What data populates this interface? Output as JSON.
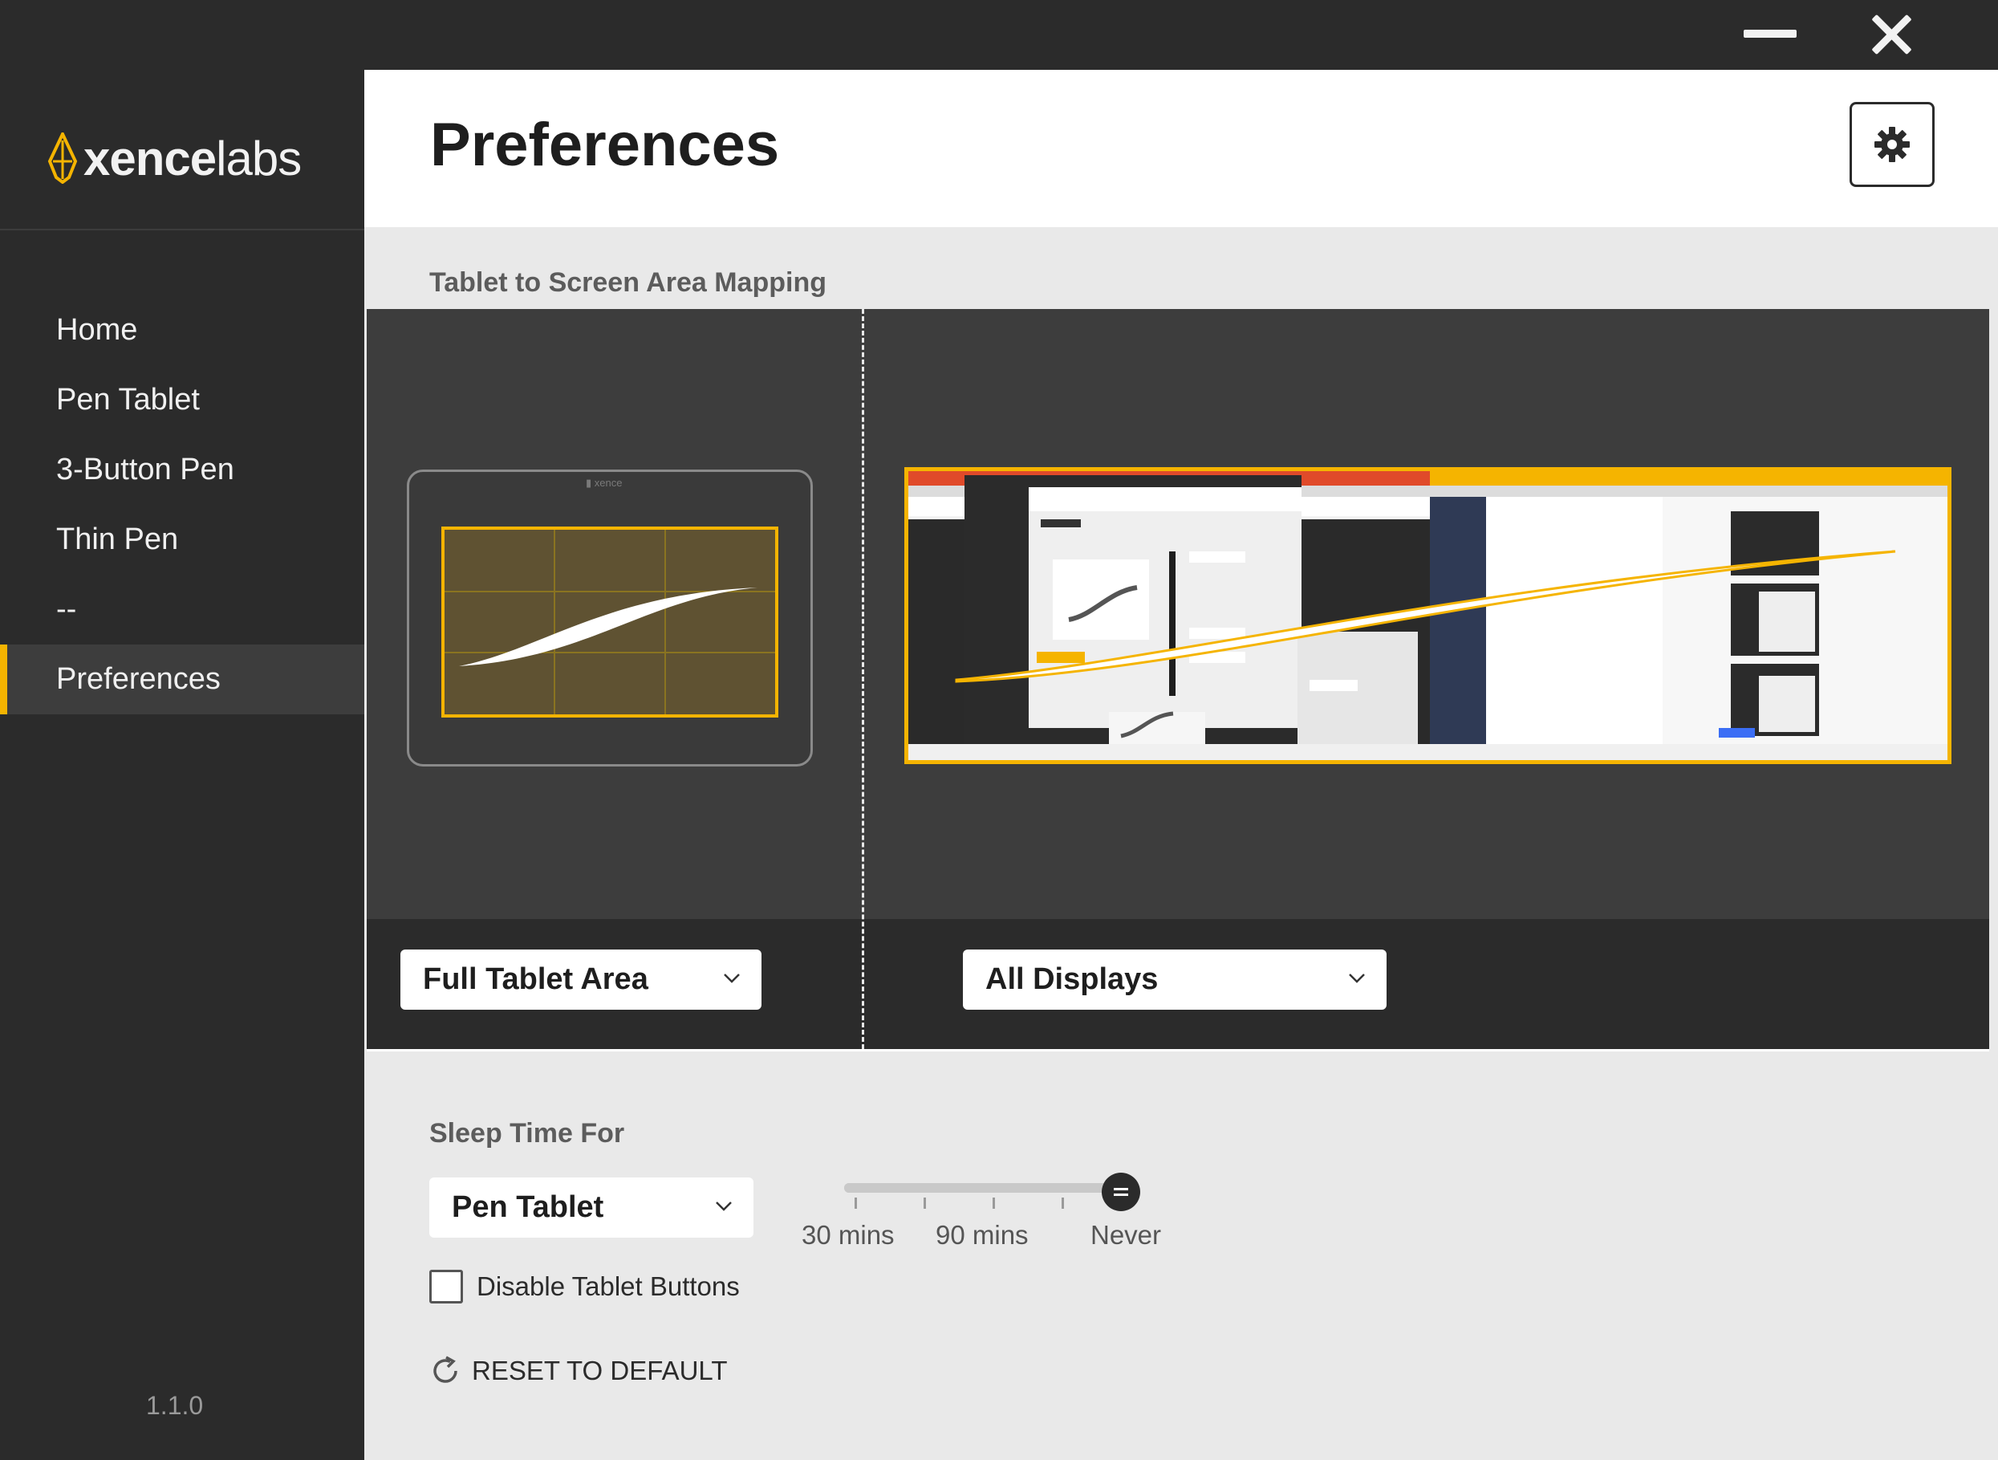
{
  "window": {
    "minimize_icon": "minimize-icon",
    "close_icon": "close-icon"
  },
  "brand": {
    "name_part1": "xence",
    "name_part2": "labs",
    "accent": "#f5b400"
  },
  "sidebar": {
    "items": [
      {
        "label": "Home"
      },
      {
        "label": "Pen Tablet"
      },
      {
        "label": "3-Button Pen"
      },
      {
        "label": "Thin Pen"
      },
      {
        "label": "--"
      },
      {
        "label": "Preferences"
      }
    ],
    "active_index": 5,
    "version": "1.1.0"
  },
  "header": {
    "title": "Preferences",
    "settings_icon": "gear-icon"
  },
  "mapping": {
    "section_label": "Tablet to Screen Area Mapping",
    "tablet_select": "Full Tablet Area",
    "display_select": "All Displays"
  },
  "sleep": {
    "section_label": "Sleep Time For",
    "device_select": "Pen Tablet",
    "slider_labels": [
      "30 mins",
      "90 mins",
      "Never"
    ],
    "slider_value": "Never",
    "slider_fraction": 1.0
  },
  "options": {
    "disable_buttons_label": "Disable Tablet Buttons",
    "disable_buttons_checked": false,
    "reset_label": "RESET TO DEFAULT"
  }
}
